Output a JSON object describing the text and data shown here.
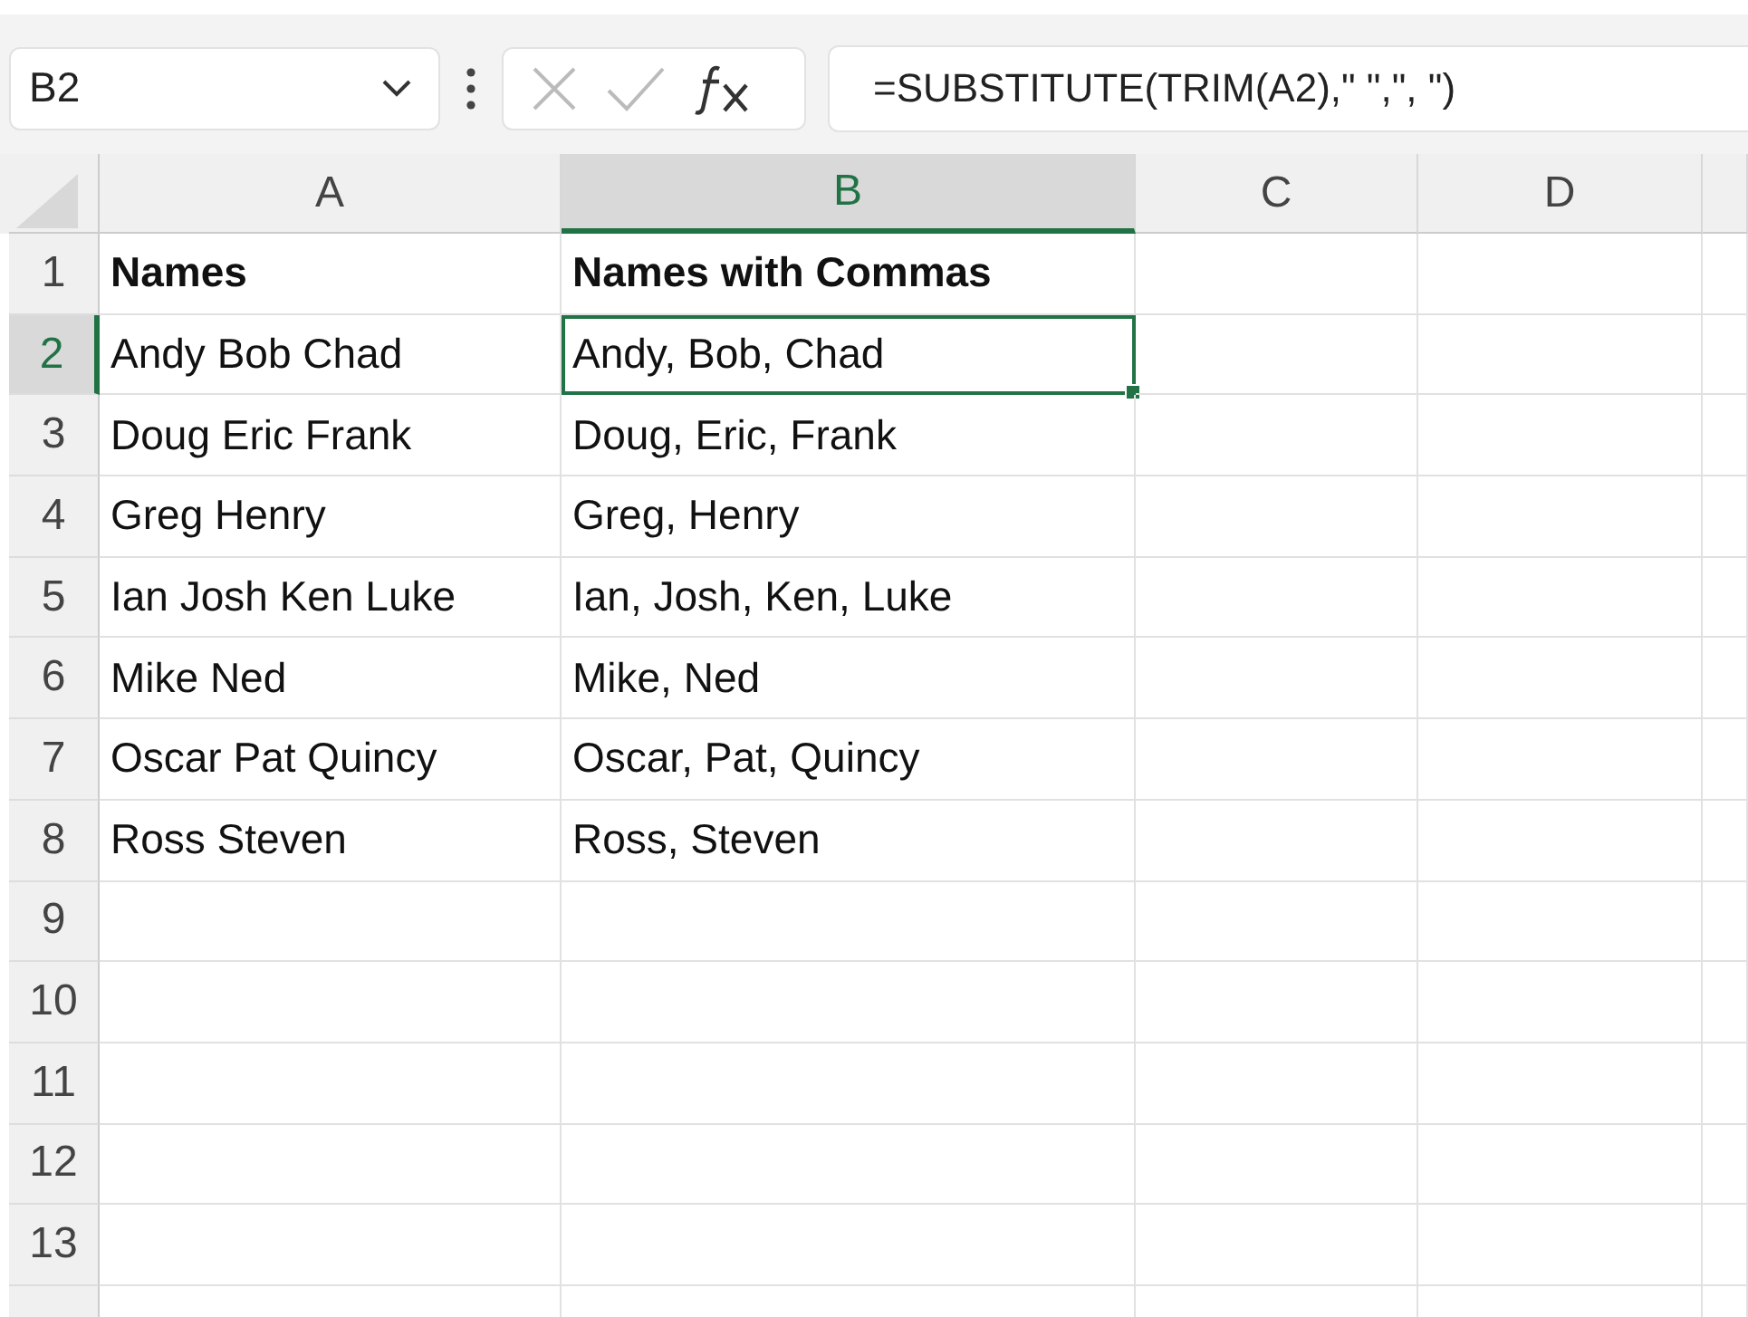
{
  "name_box": {
    "value": "B2"
  },
  "formula_bar": {
    "formula": "=SUBSTITUTE(TRIM(A2),\" \",\", \")"
  },
  "columns": [
    {
      "label": "A",
      "selected": false
    },
    {
      "label": "B",
      "selected": true
    },
    {
      "label": "C",
      "selected": false
    },
    {
      "label": "D",
      "selected": false
    }
  ],
  "rows": [
    {
      "label": "1",
      "selected": false,
      "cells": [
        {
          "text": "Names",
          "bold": true,
          "selected": false
        },
        {
          "text": "Names with Commas",
          "bold": true,
          "selected": false
        }
      ]
    },
    {
      "label": "2",
      "selected": true,
      "cells": [
        {
          "text": "Andy Bob Chad",
          "bold": false,
          "selected": false
        },
        {
          "text": "Andy, Bob, Chad",
          "bold": false,
          "selected": true
        }
      ]
    },
    {
      "label": "3",
      "selected": false,
      "cells": [
        {
          "text": "Doug Eric Frank",
          "bold": false,
          "selected": false
        },
        {
          "text": "Doug, Eric, Frank",
          "bold": false,
          "selected": false
        }
      ]
    },
    {
      "label": "4",
      "selected": false,
      "cells": [
        {
          "text": "Greg Henry",
          "bold": false,
          "selected": false
        },
        {
          "text": "Greg, Henry",
          "bold": false,
          "selected": false
        }
      ]
    },
    {
      "label": "5",
      "selected": false,
      "cells": [
        {
          "text": "Ian Josh Ken Luke",
          "bold": false,
          "selected": false
        },
        {
          "text": "Ian, Josh, Ken, Luke",
          "bold": false,
          "selected": false
        }
      ]
    },
    {
      "label": "6",
      "selected": false,
      "cells": [
        {
          "text": "Mike Ned",
          "bold": false,
          "selected": false
        },
        {
          "text": "Mike, Ned",
          "bold": false,
          "selected": false
        }
      ]
    },
    {
      "label": "7",
      "selected": false,
      "cells": [
        {
          "text": "Oscar Pat Quincy",
          "bold": false,
          "selected": false
        },
        {
          "text": "Oscar, Pat, Quincy",
          "bold": false,
          "selected": false
        }
      ]
    },
    {
      "label": "8",
      "selected": false,
      "cells": [
        {
          "text": "Ross Steven",
          "bold": false,
          "selected": false
        },
        {
          "text": "Ross, Steven",
          "bold": false,
          "selected": false
        }
      ]
    },
    {
      "label": "9",
      "selected": false,
      "cells": []
    },
    {
      "label": "10",
      "selected": false,
      "cells": []
    },
    {
      "label": "11",
      "selected": false,
      "cells": []
    },
    {
      "label": "12",
      "selected": false,
      "cells": []
    },
    {
      "label": "13",
      "selected": false,
      "cells": []
    }
  ]
}
